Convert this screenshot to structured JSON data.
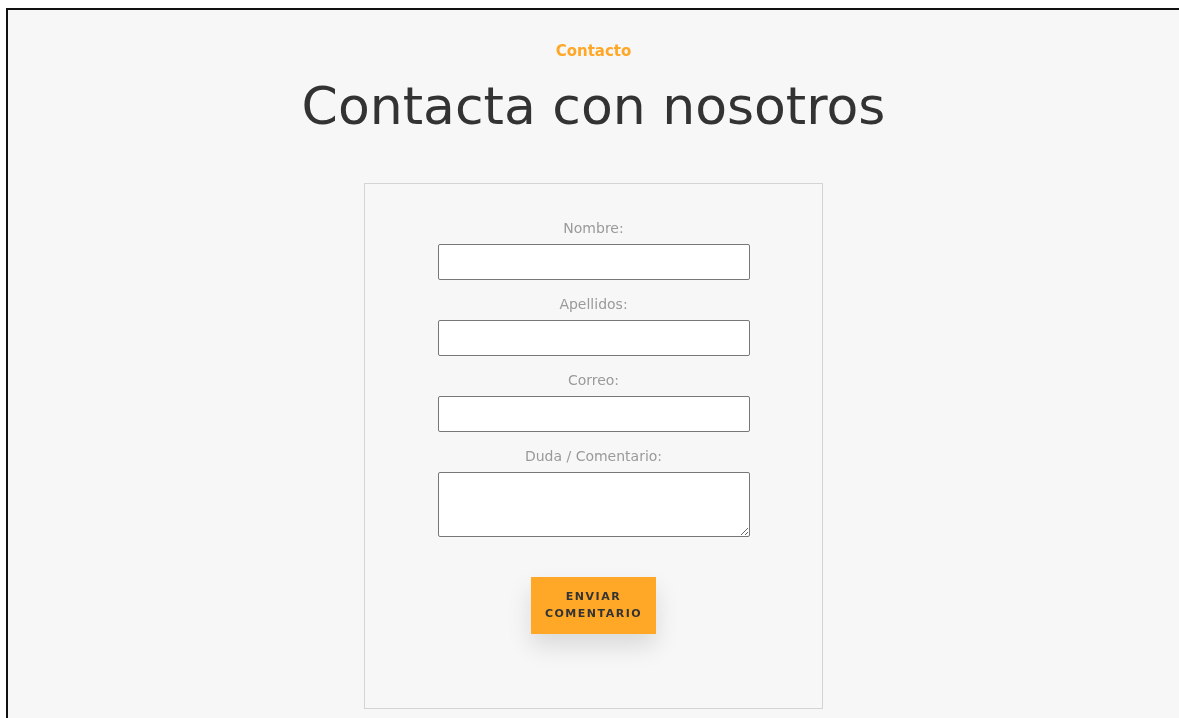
{
  "eyebrow": "Contacto",
  "title": "Contacta con nosotros",
  "form": {
    "fields": [
      {
        "label": "Nombre:",
        "kind": "input"
      },
      {
        "label": "Apellidos:",
        "kind": "input"
      },
      {
        "label": "Correo:",
        "kind": "input"
      },
      {
        "label": "Duda / Comentario:",
        "kind": "textarea"
      }
    ],
    "submit": "ENVIAR COMENTARIO"
  }
}
